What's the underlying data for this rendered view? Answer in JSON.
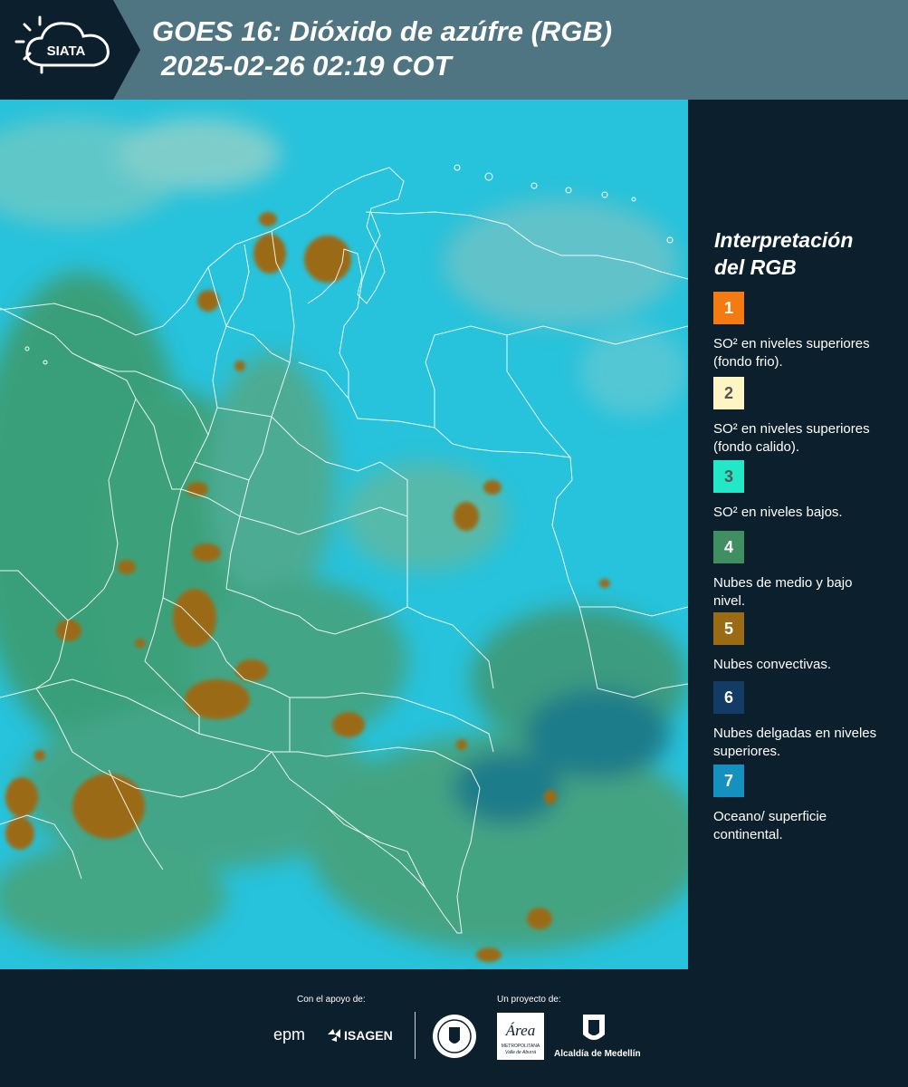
{
  "header": {
    "logo_text": "SIATA",
    "title": "GOES 16: Dióxido de azúfre (RGB)",
    "subtitle": "2025-02-26 02:19 COT"
  },
  "legend": {
    "title_line1": "Interpretación",
    "title_line2": "del RGB",
    "items": [
      {
        "number": "1",
        "color": "#f47a12",
        "text_color": "#ffffff",
        "text": "SO² en niveles superiores (fondo frio)."
      },
      {
        "number": "2",
        "color": "#fdf6c4",
        "text_color": "#555555",
        "text": "SO² en niveles superiores (fondo calido)."
      },
      {
        "number": "3",
        "color": "#23e8c8",
        "text_color": "#555555",
        "text": "SO² en niveles bajos."
      },
      {
        "number": "4",
        "color": "#3f8f63",
        "text_color": "#ffffff",
        "text": "Nubes de medio y bajo nivel."
      },
      {
        "number": "5",
        "color": "#9b6a14",
        "text_color": "#ffffff",
        "text": "Nubes convectivas."
      },
      {
        "number": "6",
        "color": "#123b66",
        "text_color": "#ffffff",
        "text": "Nubes delgadas en niveles superiores."
      },
      {
        "number": "7",
        "color": "#1591bf",
        "text_color": "#ffffff",
        "text": "Oceano/ superficie continental."
      }
    ]
  },
  "footer": {
    "support_label": "Con el apoyo de:",
    "project_label": "Un proyecto de:",
    "sponsors": [
      "epm",
      "ISAGEN"
    ],
    "partner_area_name": "Área",
    "partner_area_sub": "METROPOLITANA",
    "partner_area_sub2": "Valle de Aburrá",
    "partner_alcaldia": "Alcaldía de Medellín"
  },
  "colors": {
    "header_bg": "#4f7482",
    "page_bg": "#0c1f2d",
    "ocean": "#22bcd6",
    "land_green": "#3f8f63",
    "convective": "#9b6a14"
  }
}
